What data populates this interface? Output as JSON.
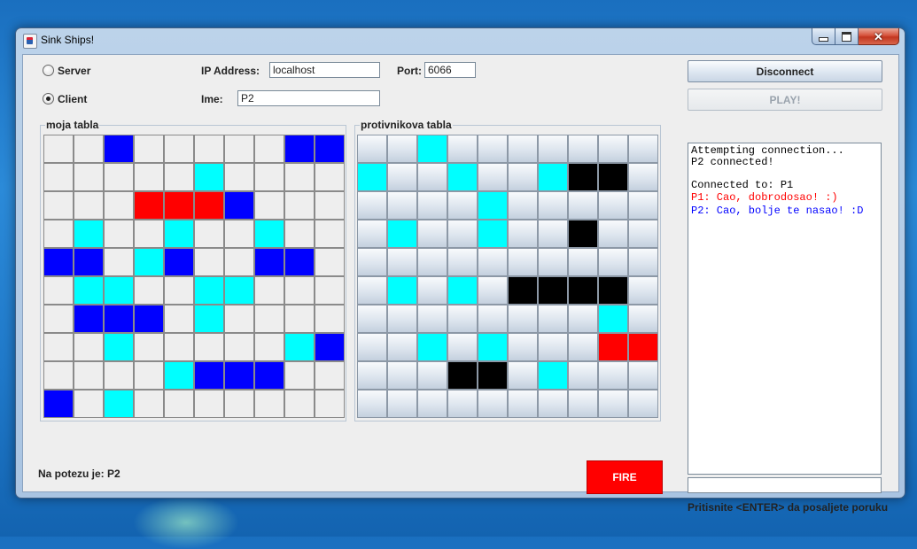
{
  "window": {
    "title": "Sink Ships!"
  },
  "connection": {
    "server_label": "Server",
    "client_label": "Client",
    "mode": "client",
    "ip_label": "IP Address:",
    "ip_value": "localhost",
    "port_label": "Port:",
    "port_value": "6066",
    "name_label": "Ime:",
    "name_value": "P2"
  },
  "buttons": {
    "disconnect": "Disconnect",
    "play": "PLAY!",
    "fire": "FIRE"
  },
  "my_board": {
    "title": "moja tabla",
    "cells": [
      [
        "",
        "",
        "B",
        "",
        "",
        "",
        "",
        "",
        "B",
        "B"
      ],
      [
        "",
        "",
        "",
        "",
        "",
        "C",
        "",
        "",
        "",
        ""
      ],
      [
        "",
        "",
        "",
        "R",
        "R",
        "R",
        "B",
        "",
        "",
        ""
      ],
      [
        "",
        "C",
        "",
        "",
        "C",
        "",
        "",
        "C",
        "",
        ""
      ],
      [
        "B",
        "B",
        "",
        "C",
        "B",
        "",
        "",
        "B",
        "B",
        ""
      ],
      [
        "",
        "C",
        "C",
        "",
        "",
        "C",
        "C",
        "",
        "",
        ""
      ],
      [
        "",
        "B",
        "B",
        "B",
        "",
        "C",
        "",
        "",
        "",
        ""
      ],
      [
        "",
        "",
        "C",
        "",
        "",
        "",
        "",
        "",
        "C",
        "B"
      ],
      [
        "",
        "",
        "",
        "",
        "C",
        "B",
        "B",
        "B",
        "",
        ""
      ],
      [
        "B",
        "",
        "C",
        "",
        "",
        "",
        "",
        "",
        "",
        ""
      ]
    ]
  },
  "enemy_board": {
    "title": "protivnikova tabla",
    "cells": [
      [
        "",
        "",
        "C",
        "",
        "",
        "",
        "",
        "",
        "",
        ""
      ],
      [
        "C",
        "",
        "",
        "C",
        "",
        "",
        "C",
        "K",
        "K",
        ""
      ],
      [
        "",
        "",
        "",
        "",
        "C",
        "",
        "",
        "",
        "",
        ""
      ],
      [
        "",
        "C",
        "",
        "",
        "C",
        "",
        "",
        "K",
        "",
        ""
      ],
      [
        "",
        "",
        "",
        "",
        "",
        "",
        "",
        "",
        "",
        ""
      ],
      [
        "",
        "C",
        "",
        "C",
        "",
        "K",
        "K",
        "K",
        "K",
        ""
      ],
      [
        "",
        "",
        "",
        "",
        "",
        "",
        "",
        "",
        "C",
        ""
      ],
      [
        "",
        "",
        "C",
        "",
        "C",
        "",
        "",
        "",
        "R",
        "R"
      ],
      [
        "",
        "",
        "",
        "K",
        "K",
        "",
        "C",
        "",
        "",
        ""
      ],
      [
        "",
        "",
        "",
        "",
        "",
        "",
        "",
        "",
        "",
        ""
      ]
    ]
  },
  "cell_colors": {
    "C": "#00ffff",
    "B": "#0000ff",
    "R": "#ff0000",
    "K": "#000000"
  },
  "turn_text": "Na potezu je: P2",
  "chat": {
    "lines": [
      {
        "text": "Attempting connection...",
        "color": "#000000"
      },
      {
        "text": "P2 connected!",
        "color": "#000000"
      },
      {
        "text": "",
        "color": "#000000"
      },
      {
        "text": "Connected to: P1",
        "color": "#000000"
      },
      {
        "text": "P1: Cao, dobrodosao! :)",
        "color": "#ff0000"
      },
      {
        "text": "P2: Cao, bolje te nasao! :D",
        "color": "#0000ff"
      }
    ],
    "input_value": "",
    "hint": "Pritisnite <ENTER> da posaljete poruku"
  }
}
